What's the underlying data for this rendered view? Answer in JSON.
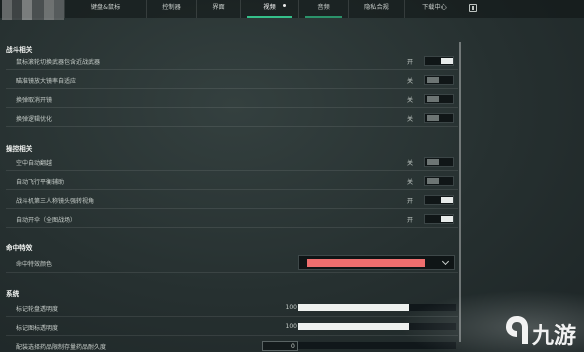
{
  "tabs": [
    {
      "label": "键盘&鼠标",
      "active": false
    },
    {
      "label": "控制器",
      "active": false
    },
    {
      "label": "界面",
      "active": false
    },
    {
      "label": "视频",
      "active": true
    },
    {
      "label": "音频",
      "active": false
    },
    {
      "label": "隐私合规",
      "active": false
    },
    {
      "label": "下载中心",
      "active": false
    }
  ],
  "sections": {
    "combat": {
      "title": "战斗相关",
      "rows": [
        {
          "label": "鼠标滚轮切换武器包含近战武器",
          "state": "开",
          "on": true
        },
        {
          "label": "瞄准镜放大镜率自适应",
          "state": "关",
          "on": false
        },
        {
          "label": "换弹取消开镜",
          "state": "关",
          "on": false
        },
        {
          "label": "换弹逻辑优化",
          "state": "关",
          "on": false
        }
      ]
    },
    "control": {
      "title": "操控相关",
      "rows": [
        {
          "label": "空中自动翻越",
          "state": "关",
          "on": false
        },
        {
          "label": "自动飞行平衡辅助",
          "state": "关",
          "on": false
        },
        {
          "label": "战斗机第三人称镜头强转视角",
          "state": "开",
          "on": true
        },
        {
          "label": "自动开伞（全图战场）",
          "state": "开",
          "on": true
        }
      ]
    },
    "hit": {
      "title": "命中特效",
      "row_label": "命中特效颜色",
      "color": "#ee6e6e"
    },
    "system": {
      "title": "系统",
      "sliders": [
        {
          "label": "标记轮盘透明度",
          "value": "100",
          "fill": 0.7
        },
        {
          "label": "标记图标透明度",
          "value": "100",
          "fill": 0.7
        },
        {
          "label": "配装选择药品限制存量药品耐久度",
          "value": "0",
          "fill": 0
        }
      ]
    }
  },
  "watermark": {
    "text": "九游",
    "color": "#f2f2f2"
  }
}
